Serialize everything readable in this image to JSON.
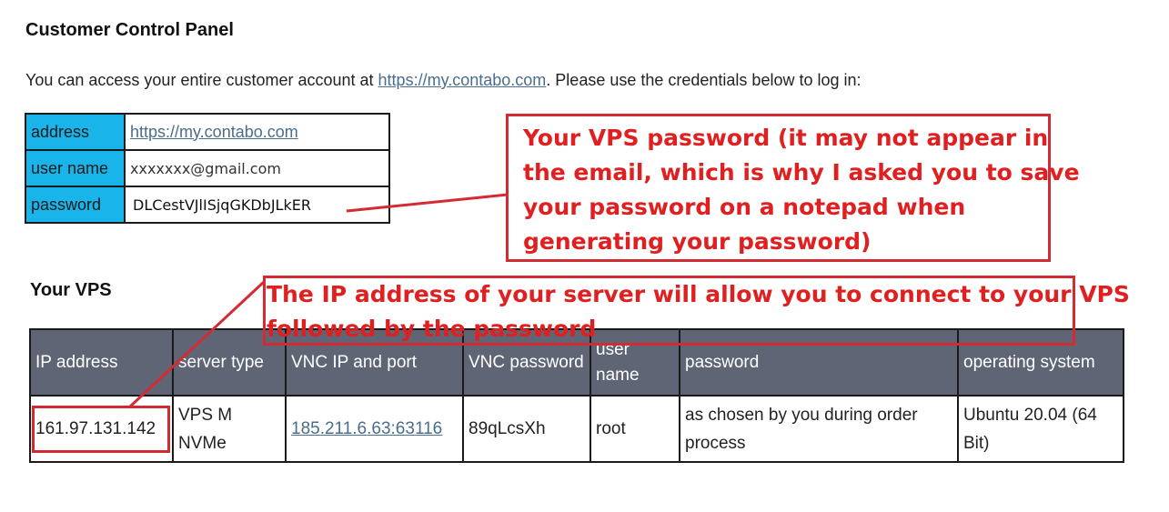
{
  "panel": {
    "title": "Customer Control Panel",
    "intro_before": "You can access your entire customer account at ",
    "intro_link": "https://my.contabo.com",
    "intro_after": ". Please use the credentials below to log in:"
  },
  "credentials": {
    "rows": [
      {
        "key": "address",
        "value": "https://my.contabo.com"
      },
      {
        "key": "user name",
        "value": "xxxxxxx@gmail.com"
      },
      {
        "key": "password",
        "value": "DLCestVJlISjqGKDbJLkER"
      }
    ]
  },
  "vps": {
    "title": "Your VPS",
    "headers": [
      "IP address",
      "server type",
      "VNC IP and port",
      "VNC password",
      "user name",
      "password",
      "operating system"
    ],
    "row": {
      "ip": "161.97.131.142",
      "server_type": "VPS M NVMe",
      "vnc": "185.211.6.63:63116",
      "vnc_password": "89qLcsXh",
      "user": "root",
      "password": "as chosen by you during order process",
      "os": "Ubuntu 20.04 (64 Bit)"
    }
  },
  "annotations": {
    "password_note": [
      "Your VPS password (it may not appear in",
      "the email, which is why I asked you to save",
      "your password on a notepad when",
      "generating your password)"
    ],
    "ip_note": [
      "The IP address of your server will allow you to connect to your VPS",
      "followed by the password"
    ],
    "color": "#e02020"
  },
  "colors": {
    "credential_key_bg": "#18b4ea",
    "table_header_bg": "#5f6575",
    "link": "#4a6d8c"
  }
}
